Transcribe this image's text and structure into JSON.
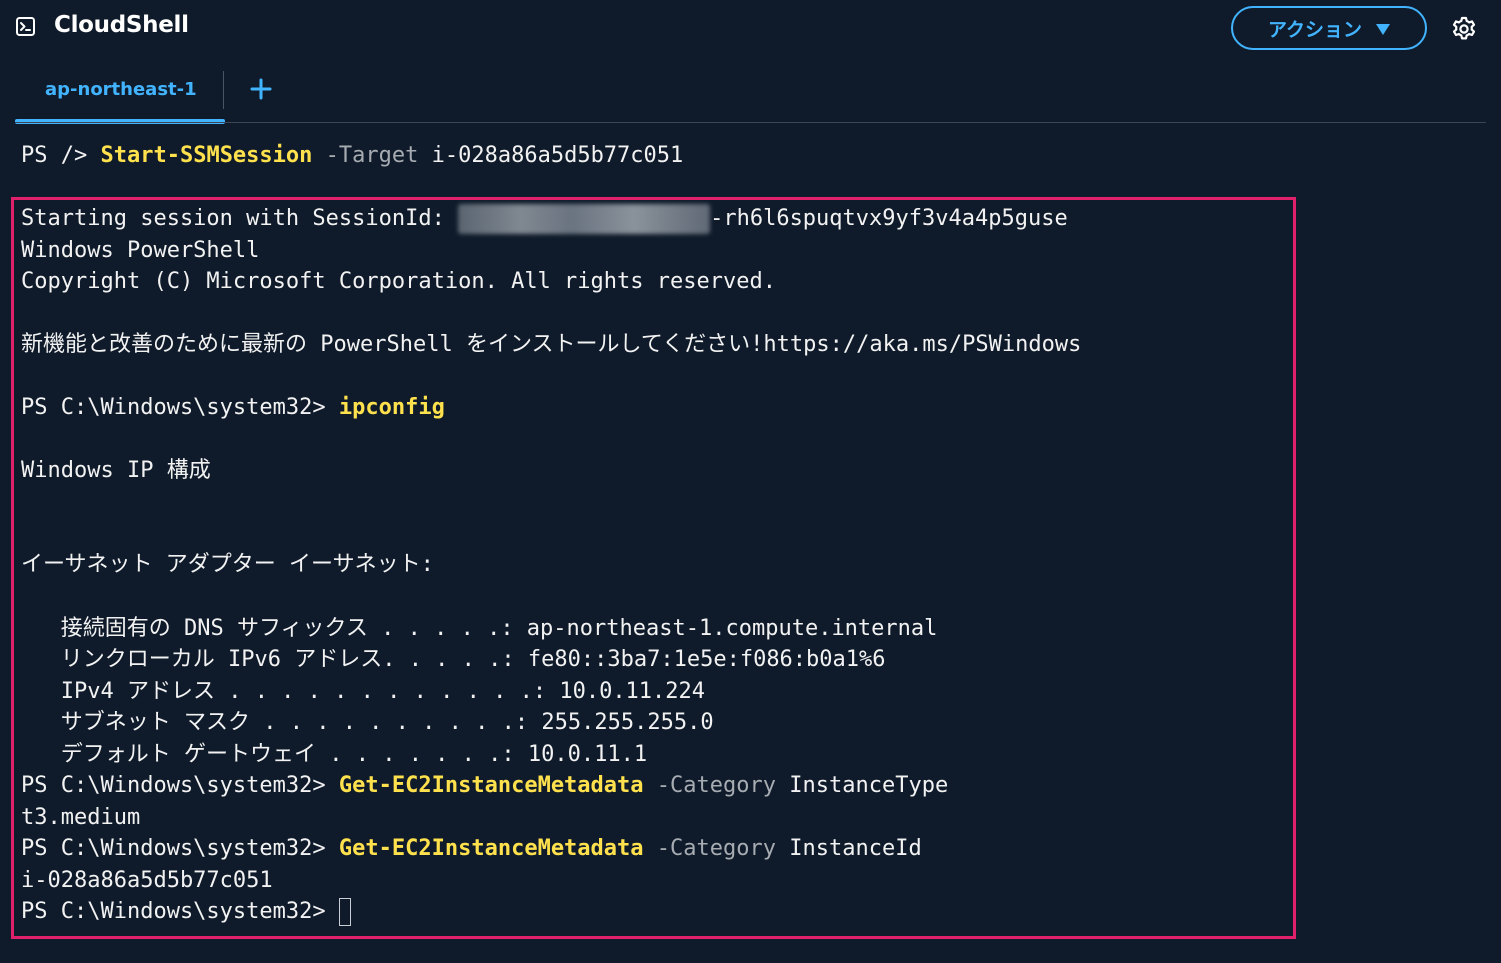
{
  "header": {
    "title": "CloudShell",
    "actions_label": "アクション"
  },
  "tabs": [
    {
      "label": "ap-northeast-1",
      "active": true
    }
  ],
  "colors": {
    "background": "#0f1b2a",
    "accent": "#42b4ff",
    "command": "#ffe14d",
    "parameter": "#a7acb2",
    "highlight_border": "#e0206a"
  },
  "icons": {
    "app": "terminal-icon",
    "actions_caret": "caret-down-icon",
    "settings": "gear-icon",
    "add_tab": "plus-icon"
  },
  "terminal": {
    "line_intro": {
      "prompt": "PS />",
      "command": "Start-SSMSession",
      "param": "-Target",
      "arg": "i-028a86a5d5b77c051"
    },
    "session_prefix": "Starting session with SessionId: ",
    "session_suffix": "-rh6l6spuqtvx9yf3v4a4p5guse",
    "windows_powershell": "Windows PowerShell",
    "copyright": "Copyright (C) Microsoft Corporation. All rights reserved.",
    "install_notice": "新機能と改善のために最新の PowerShell をインストールしてください!https://aka.ms/PSWindows",
    "prompt": "PS C:\\Windows\\system32>",
    "cmd_ipconfig": "ipconfig",
    "ip_title": "Windows IP 構成",
    "adapter_header": "イーサネット アダプター イーサネット:",
    "dns_suffix": "   接続固有の DNS サフィックス . . . . .: ap-northeast-1.compute.internal",
    "ipv6": "   リンクローカル IPv6 アドレス. . . . .: fe80::3ba7:1e5e:f086:b0a1%6",
    "ipv4": "   IPv4 アドレス . . . . . . . . . . . .: 10.0.11.224",
    "subnet": "   サブネット マスク . . . . . . . . . .: 255.255.255.0",
    "gateway": "   デフォルト ゲートウェイ . . . . . . .: 10.0.11.1",
    "cmd_metadata": "Get-EC2InstanceMetadata",
    "param_category": "-Category",
    "arg_instance_type": "InstanceType",
    "out_instance_type": "t3.medium",
    "arg_instance_id": "InstanceId",
    "out_instance_id": "i-028a86a5d5b77c051"
  }
}
